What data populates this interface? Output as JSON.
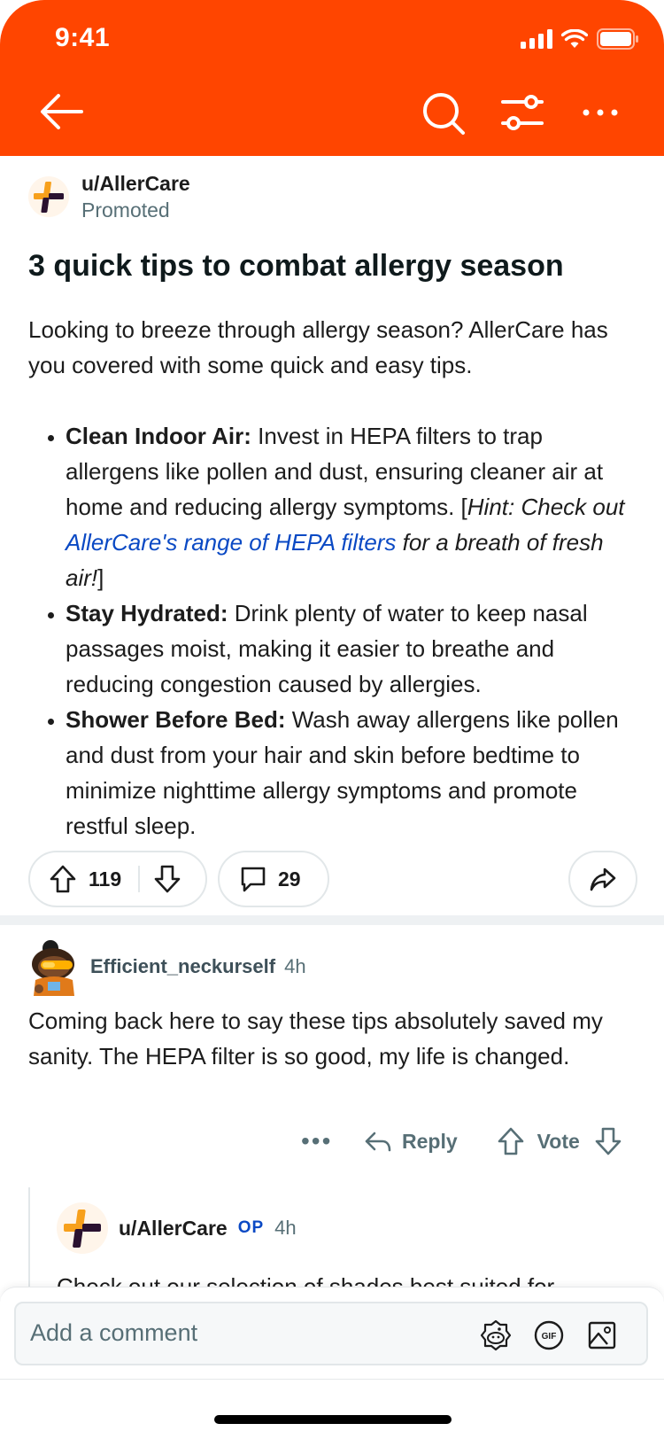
{
  "status_bar": {
    "time": "9:41"
  },
  "post": {
    "author": "u/AllerCare",
    "promoted_label": "Promoted",
    "title": "3 quick tips to combat allergy season",
    "intro": "Looking to breeze through allergy season? AllerCare has you covered with some quick and easy tips.",
    "tips": [
      {
        "heading": "Clean Indoor Air:",
        "text": " Invest in HEPA filters to trap allergens like pollen and dust, ensuring cleaner air at home and reducing allergy symptoms. [",
        "hint_prefix": "Hint: Check out ",
        "hint_link": "AllerCare's range of HEPA filters",
        "hint_suffix": " for a breath of fresh air!",
        "closing": "]"
      },
      {
        "heading": "Stay Hydrated:",
        "text": " Drink plenty of water to keep nasal passages moist, making it easier to breathe and reducing congestion caused by allergies."
      },
      {
        "heading": "Shower Before Bed:",
        "text": " Wash away allergens like pollen and dust from your hair and skin before bedtime to minimize nighttime allergy symptoms and promote restful sleep."
      }
    ],
    "upvotes": "119",
    "comments": "29"
  },
  "comment": {
    "author": "Efficient_neckurself",
    "time": "4h",
    "text": "Coming back here to say these tips absolutely saved my sanity. The HEPA filter is so good, my life is changed.",
    "more": "•••",
    "reply_label": "Reply",
    "vote_label": "Vote"
  },
  "reply": {
    "author": "u/AllerCare",
    "op_badge": "OP",
    "time": "4h",
    "text": "Check out our selection of shades best suited for"
  },
  "composer": {
    "placeholder": "Add a comment"
  },
  "colors": {
    "header": "#ff4500",
    "link": "#0a49c4",
    "brand_orange": "#f7a01c",
    "brand_dark": "#2a1230"
  }
}
